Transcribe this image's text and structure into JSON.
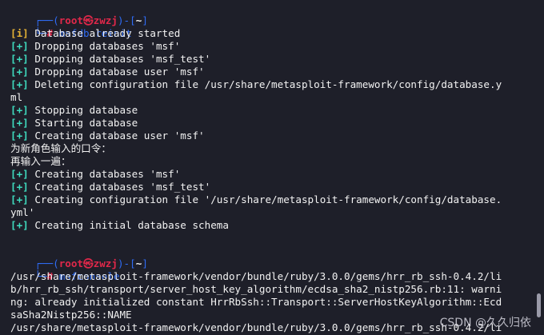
{
  "prompt1": {
    "corner_top": "┌──(",
    "user": "root",
    "skull": "㉿",
    "host": "zwzj",
    "mid": ")-[",
    "path": "~",
    "close": "]",
    "corner_bottom": "└─",
    "hash": "#",
    "command": "msfdb reinit"
  },
  "output1": [
    {
      "prefix": "[i]",
      "kind": "info",
      "text": " Database already started"
    },
    {
      "prefix": "[+]",
      "kind": "plus",
      "text": " Dropping databases 'msf'"
    },
    {
      "prefix": "[+]",
      "kind": "plus",
      "text": " Dropping databases 'msf_test'"
    },
    {
      "prefix": "[+]",
      "kind": "plus",
      "text": " Dropping database user 'msf'"
    },
    {
      "prefix": "[+]",
      "kind": "plus",
      "text": " Deleting configuration file /usr/share/metasploit-framework/config/database.y"
    },
    {
      "prefix": "",
      "kind": "plain",
      "text": "ml"
    },
    {
      "prefix": "[+]",
      "kind": "plus",
      "text": " Stopping database"
    },
    {
      "prefix": "[+]",
      "kind": "plus",
      "text": " Starting database"
    },
    {
      "prefix": "[+]",
      "kind": "plus",
      "text": " Creating database user 'msf'"
    },
    {
      "prefix": "",
      "kind": "plain",
      "text": "为新角色输入的口令："
    },
    {
      "prefix": "",
      "kind": "plain",
      "text": "再输入一遍："
    },
    {
      "prefix": "[+]",
      "kind": "plus",
      "text": " Creating databases 'msf'"
    },
    {
      "prefix": "[+]",
      "kind": "plus",
      "text": " Creating databases 'msf_test'"
    },
    {
      "prefix": "[+]",
      "kind": "plus",
      "text": " Creating configuration file '/usr/share/metasploit-framework/config/database."
    },
    {
      "prefix": "",
      "kind": "plain",
      "text": "yml'"
    },
    {
      "prefix": "[+]",
      "kind": "plus",
      "text": " Creating initial database schema"
    }
  ],
  "prompt2": {
    "corner_top": "┌──(",
    "user": "root",
    "skull": "㉿",
    "host": "zwzj",
    "mid": ")-[",
    "path": "~",
    "close": "]",
    "corner_bottom": "└─",
    "hash": "#",
    "command": "msfconsole"
  },
  "output2": [
    "/usr/share/metasploit-framework/vendor/bundle/ruby/3.0.0/gems/hrr_rb_ssh-0.4.2/li",
    "b/hrr_rb_ssh/transport/server_host_key_algorithm/ecdsa_sha2_nistp256.rb:11: warni",
    "ng: already initialized constant HrrRbSsh::Transport::ServerHostKeyAlgorithm::Ecd",
    "saSha2Nistp256::NAME",
    "/usr/share/metasploit-framework/vendor/bundle/ruby/3.0.0/gems/hrr_rb_ssh-0.4.2/li"
  ],
  "watermark": "CSDN @久久归依",
  "colors": {
    "background": "#1e1f29",
    "prompt_blue": "#2f6cf5",
    "prompt_red": "#e0284a",
    "plus_cyan": "#3fdcbf",
    "info_yellow": "#e5b335",
    "text": "#f2f2f2"
  }
}
